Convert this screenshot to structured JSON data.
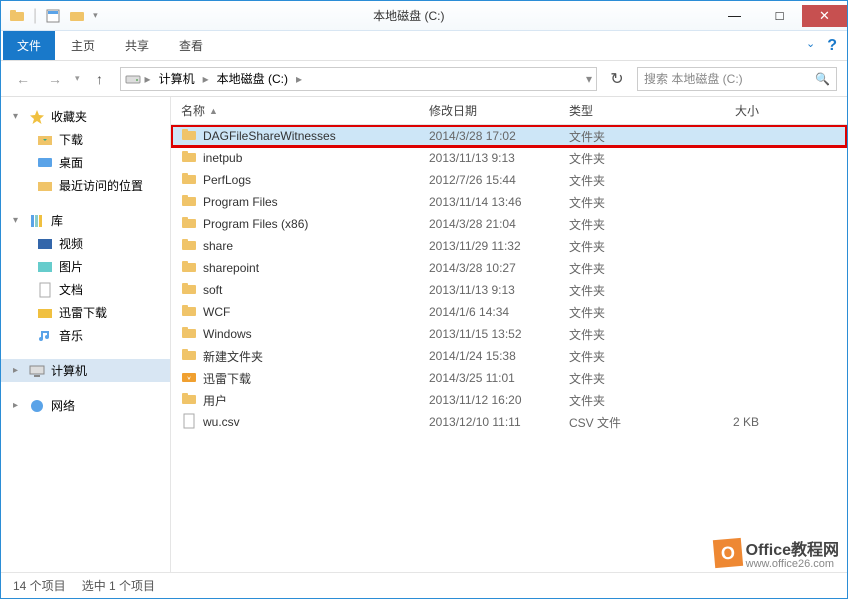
{
  "window": {
    "title": "本地磁盘 (C:)"
  },
  "ribbon": {
    "file": "文件",
    "home": "主页",
    "share": "共享",
    "view": "查看"
  },
  "nav": {
    "breadcrumb": {
      "computer": "计算机",
      "drive": "本地磁盘 (C:)"
    },
    "search_placeholder": "搜索 本地磁盘 (C:)"
  },
  "sidebar": {
    "favorites": {
      "label": "收藏夹",
      "children": [
        {
          "label": "下载"
        },
        {
          "label": "桌面"
        },
        {
          "label": "最近访问的位置"
        }
      ]
    },
    "libraries": {
      "label": "库",
      "children": [
        {
          "label": "视频"
        },
        {
          "label": "图片"
        },
        {
          "label": "文档"
        },
        {
          "label": "迅雷下载"
        },
        {
          "label": "音乐"
        }
      ]
    },
    "computer": {
      "label": "计算机"
    },
    "network": {
      "label": "网络"
    }
  },
  "columns": {
    "name": "名称",
    "date": "修改日期",
    "type": "类型",
    "size": "大小"
  },
  "items": [
    {
      "name": "DAGFileShareWitnesses",
      "date": "2014/3/28 17:02",
      "type": "文件夹",
      "size": "",
      "icon": "folder",
      "selected": true,
      "highlighted": true
    },
    {
      "name": "inetpub",
      "date": "2013/11/13 9:13",
      "type": "文件夹",
      "size": "",
      "icon": "folder"
    },
    {
      "name": "PerfLogs",
      "date": "2012/7/26 15:44",
      "type": "文件夹",
      "size": "",
      "icon": "folder"
    },
    {
      "name": "Program Files",
      "date": "2013/11/14 13:46",
      "type": "文件夹",
      "size": "",
      "icon": "folder"
    },
    {
      "name": "Program Files (x86)",
      "date": "2014/3/28 21:04",
      "type": "文件夹",
      "size": "",
      "icon": "folder"
    },
    {
      "name": "share",
      "date": "2013/11/29 11:32",
      "type": "文件夹",
      "size": "",
      "icon": "folder"
    },
    {
      "name": "sharepoint",
      "date": "2014/3/28 10:27",
      "type": "文件夹",
      "size": "",
      "icon": "folder"
    },
    {
      "name": "soft",
      "date": "2013/11/13 9:13",
      "type": "文件夹",
      "size": "",
      "icon": "folder"
    },
    {
      "name": "WCF",
      "date": "2014/1/6 14:34",
      "type": "文件夹",
      "size": "",
      "icon": "folder"
    },
    {
      "name": "Windows",
      "date": "2013/11/15 13:52",
      "type": "文件夹",
      "size": "",
      "icon": "folder"
    },
    {
      "name": "新建文件夹",
      "date": "2014/1/24 15:38",
      "type": "文件夹",
      "size": "",
      "icon": "folder"
    },
    {
      "name": "迅雷下载",
      "date": "2014/3/25 11:01",
      "type": "文件夹",
      "size": "",
      "icon": "folder-dl"
    },
    {
      "name": "用户",
      "date": "2013/11/12 16:20",
      "type": "文件夹",
      "size": "",
      "icon": "folder"
    },
    {
      "name": "wu.csv",
      "date": "2013/12/10 11:11",
      "type": "CSV 文件",
      "size": "2 KB",
      "icon": "file"
    }
  ],
  "status": {
    "count": "14 个项目",
    "selected": "选中 1 个项目"
  },
  "watermark": {
    "title": "Office教程网",
    "url": "www.office26.com"
  }
}
